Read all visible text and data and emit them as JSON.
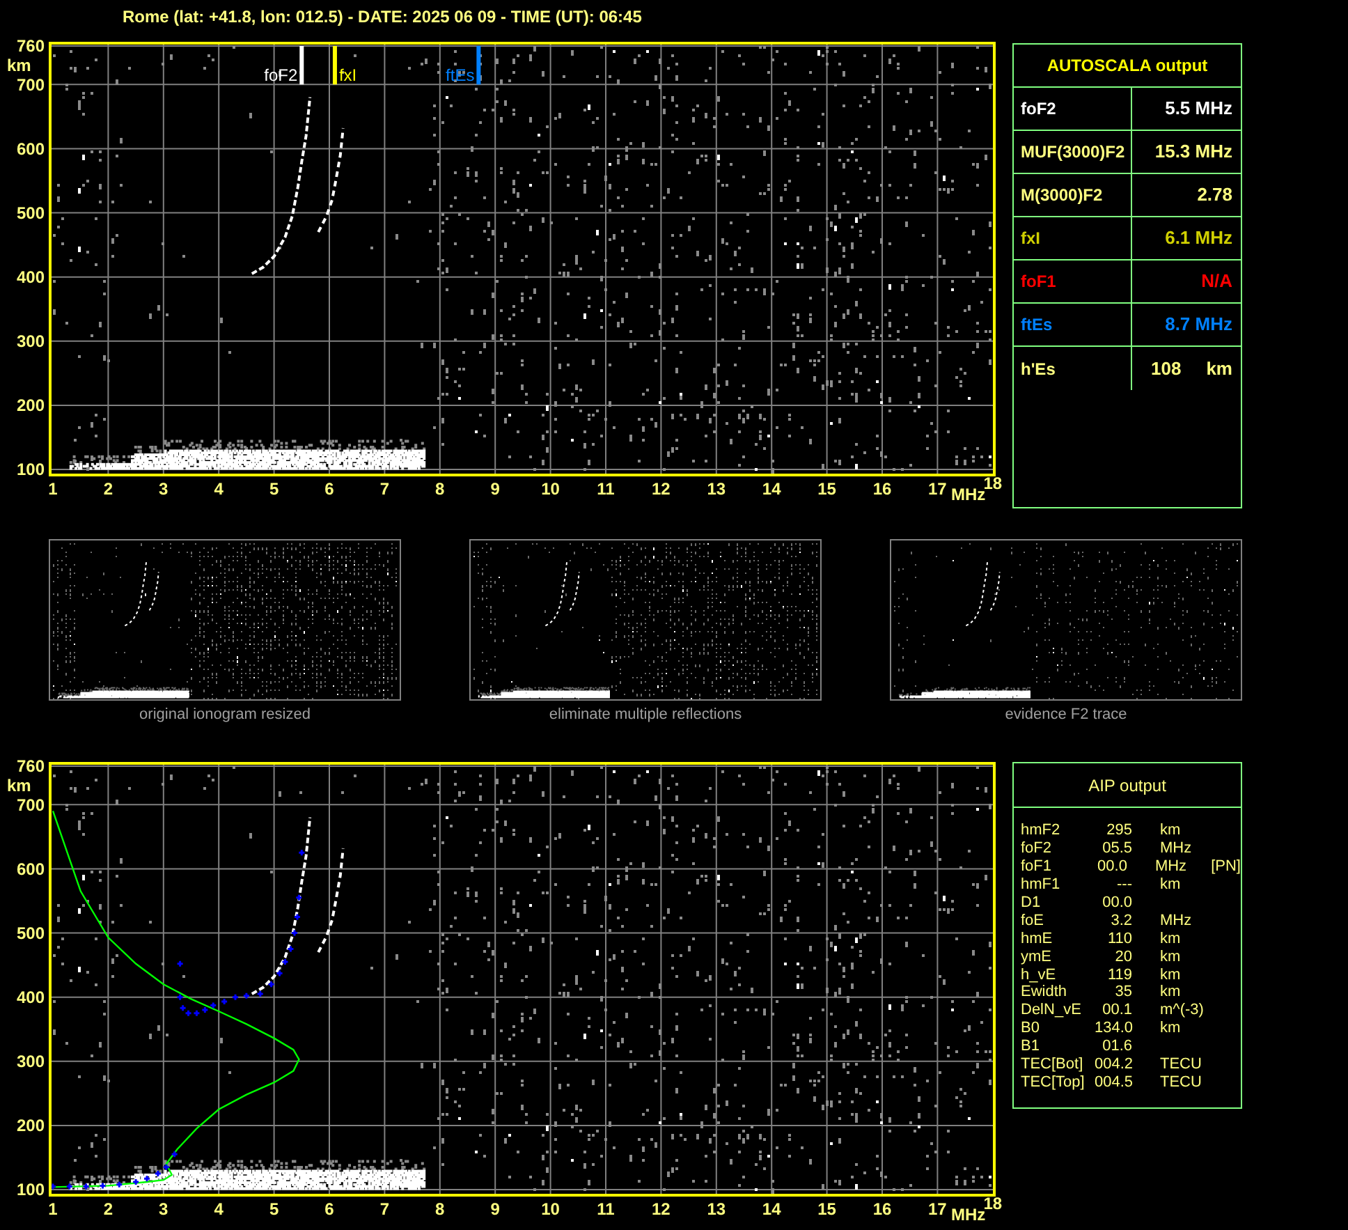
{
  "header": "Rome (lat: +41.8, lon: 012.5) - DATE: 2025 06 09 - TIME (UT): 06:45",
  "top_plot": {
    "y_ticks": [
      "760",
      "700",
      "600",
      "500",
      "400",
      "300",
      "200",
      "100"
    ],
    "y_unit": "km",
    "x_ticks": [
      "1",
      "2",
      "3",
      "4",
      "5",
      "6",
      "7",
      "8",
      "9",
      "10",
      "11",
      "12",
      "13",
      "14",
      "15",
      "16",
      "17",
      "18"
    ],
    "x_unit": "MHz",
    "markers": [
      {
        "label": "foF2",
        "color": "#ffffff"
      },
      {
        "label": "fxI",
        "color": "#ffff00"
      },
      {
        "label": "ftEs",
        "color": "#0080ff"
      }
    ]
  },
  "autoscala": {
    "title": "AUTOSCALA output",
    "rows": [
      {
        "label": "foF2",
        "value": "5.5 MHz",
        "color": "#ffffff"
      },
      {
        "label": "MUF(3000)F2",
        "value": "15.3 MHz",
        "color": "#ffff80"
      },
      {
        "label": "M(3000)F2",
        "value": "2.78",
        "color": "#ffff80"
      },
      {
        "label": "fxI",
        "value": "6.1 MHz",
        "color": "#d0d000"
      },
      {
        "label": "foF1",
        "value": "N/A",
        "color": "#ff0000"
      },
      {
        "label": "ftEs",
        "value": "8.7 MHz",
        "color": "#0080ff"
      },
      {
        "label": "h'Es",
        "value": "108",
        "unit": "km",
        "color": "#ffff80"
      }
    ]
  },
  "thumbnails": [
    {
      "caption": "original ionogram resized"
    },
    {
      "caption": "eliminate multiple reflections"
    },
    {
      "caption": "evidence F2 trace"
    }
  ],
  "bottom_plot": {
    "y_ticks": [
      "760",
      "700",
      "600",
      "500",
      "400",
      "300",
      "200",
      "100"
    ],
    "y_unit": "km",
    "x_ticks": [
      "1",
      "2",
      "3",
      "4",
      "5",
      "6",
      "7",
      "8",
      "9",
      "10",
      "11",
      "12",
      "13",
      "14",
      "15",
      "16",
      "17",
      "18"
    ],
    "x_unit": "MHz"
  },
  "aip": {
    "title": "AIP output",
    "rows": [
      {
        "label": "hmF2",
        "value": "295",
        "unit": "km"
      },
      {
        "label": "foF2",
        "value": "05.5",
        "unit": "MHz"
      },
      {
        "label": "foF1",
        "value": "00.0",
        "unit": "MHz",
        "note": "[PN]"
      },
      {
        "label": "hmF1",
        "value": "---",
        "unit": "km"
      },
      {
        "label": "D1",
        "value": "00.0"
      },
      {
        "label": "foE",
        "value": "3.2",
        "unit": "MHz"
      },
      {
        "label": "hmE",
        "value": "110",
        "unit": "km"
      },
      {
        "label": "ymE",
        "value": "20",
        "unit": "km"
      },
      {
        "label": "h_vE",
        "value": "119",
        "unit": "km"
      },
      {
        "label": "Ewidth",
        "value": "35",
        "unit": "km"
      },
      {
        "label": "DelN_vE",
        "value": "00.1",
        "unit": "m^(-3)"
      },
      {
        "label": "B0",
        "value": "134.0",
        "unit": "km"
      },
      {
        "label": "B1",
        "value": "01.6"
      },
      {
        "label": "TEC[Bot]",
        "value": "004.2",
        "unit": "TECU"
      },
      {
        "label": "TEC[Top]",
        "value": "004.5",
        "unit": "TECU"
      }
    ]
  }
}
